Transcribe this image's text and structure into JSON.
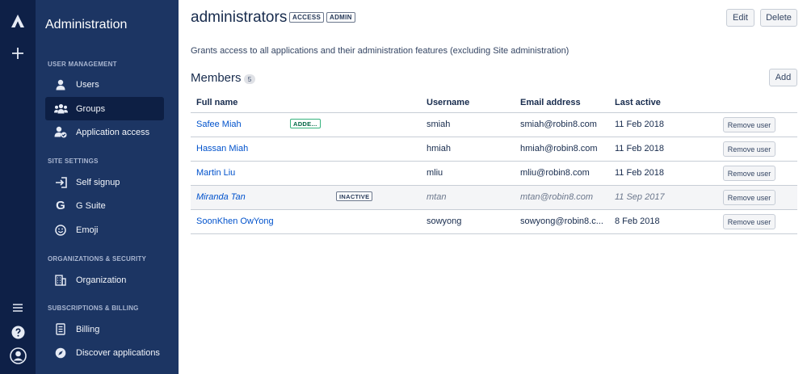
{
  "rail": {
    "icons": [
      "atlassian-logo-icon",
      "plus-icon",
      "menu-icon",
      "help-icon",
      "user-avatar-icon"
    ]
  },
  "sidebar": {
    "title": "Administration",
    "sections": [
      {
        "label": "USER MANAGEMENT",
        "items": [
          {
            "label": "Users",
            "icon": "user-icon",
            "active": false
          },
          {
            "label": "Groups",
            "icon": "group-icon",
            "active": true
          },
          {
            "label": "Application access",
            "icon": "user-check-icon",
            "active": false
          }
        ]
      },
      {
        "label": "SITE SETTINGS",
        "items": [
          {
            "label": "Self signup",
            "icon": "sign-in-icon",
            "active": false
          },
          {
            "label": "G Suite",
            "icon": "google-icon",
            "active": false
          },
          {
            "label": "Emoji",
            "icon": "smiley-icon",
            "active": false
          }
        ]
      },
      {
        "label": "ORGANIZATIONS & SECURITY",
        "items": [
          {
            "label": "Organization",
            "icon": "building-icon",
            "active": false
          }
        ]
      },
      {
        "label": "SUBSCRIPTIONS & BILLING",
        "items": [
          {
            "label": "Billing",
            "icon": "receipt-icon",
            "active": false
          },
          {
            "label": "Discover applications",
            "icon": "compass-icon",
            "active": false
          }
        ]
      }
    ]
  },
  "main": {
    "title": "administrators",
    "lozenges": [
      "ACCESS",
      "ADMIN"
    ],
    "edit_label": "Edit",
    "delete_label": "Delete",
    "description": "Grants access to all applications and their administration features (excluding Site administration)",
    "members_label": "Members",
    "members_count": "5",
    "add_label": "Add",
    "columns": [
      "Full name",
      "Username",
      "Email address",
      "Last active"
    ],
    "remove_label": "Remove user",
    "rows": [
      {
        "name": "Safee Miah",
        "tag": "ADDE...",
        "username": "smiah",
        "email": "smiah@robin8.com",
        "last_active": "11 Feb 2018",
        "inactive": false
      },
      {
        "name": "Hassan Miah",
        "tag": "",
        "username": "hmiah",
        "email": "hmiah@robin8.com",
        "last_active": "11 Feb 2018",
        "inactive": false
      },
      {
        "name": "Martin Liu",
        "tag": "",
        "username": "mliu",
        "email": "mliu@robin8.com",
        "last_active": "11 Feb 2018",
        "inactive": false
      },
      {
        "name": "Miranda Tan",
        "tag": "INACTIVE",
        "username": "mtan",
        "email": "mtan@robin8.com",
        "last_active": "11 Sep 2017",
        "inactive": true
      },
      {
        "name": "SoonKhen OwYong",
        "tag": "",
        "username": "sowyong",
        "email": "sowyong@robin8.c...",
        "last_active": "8 Feb 2018",
        "inactive": false
      }
    ]
  }
}
